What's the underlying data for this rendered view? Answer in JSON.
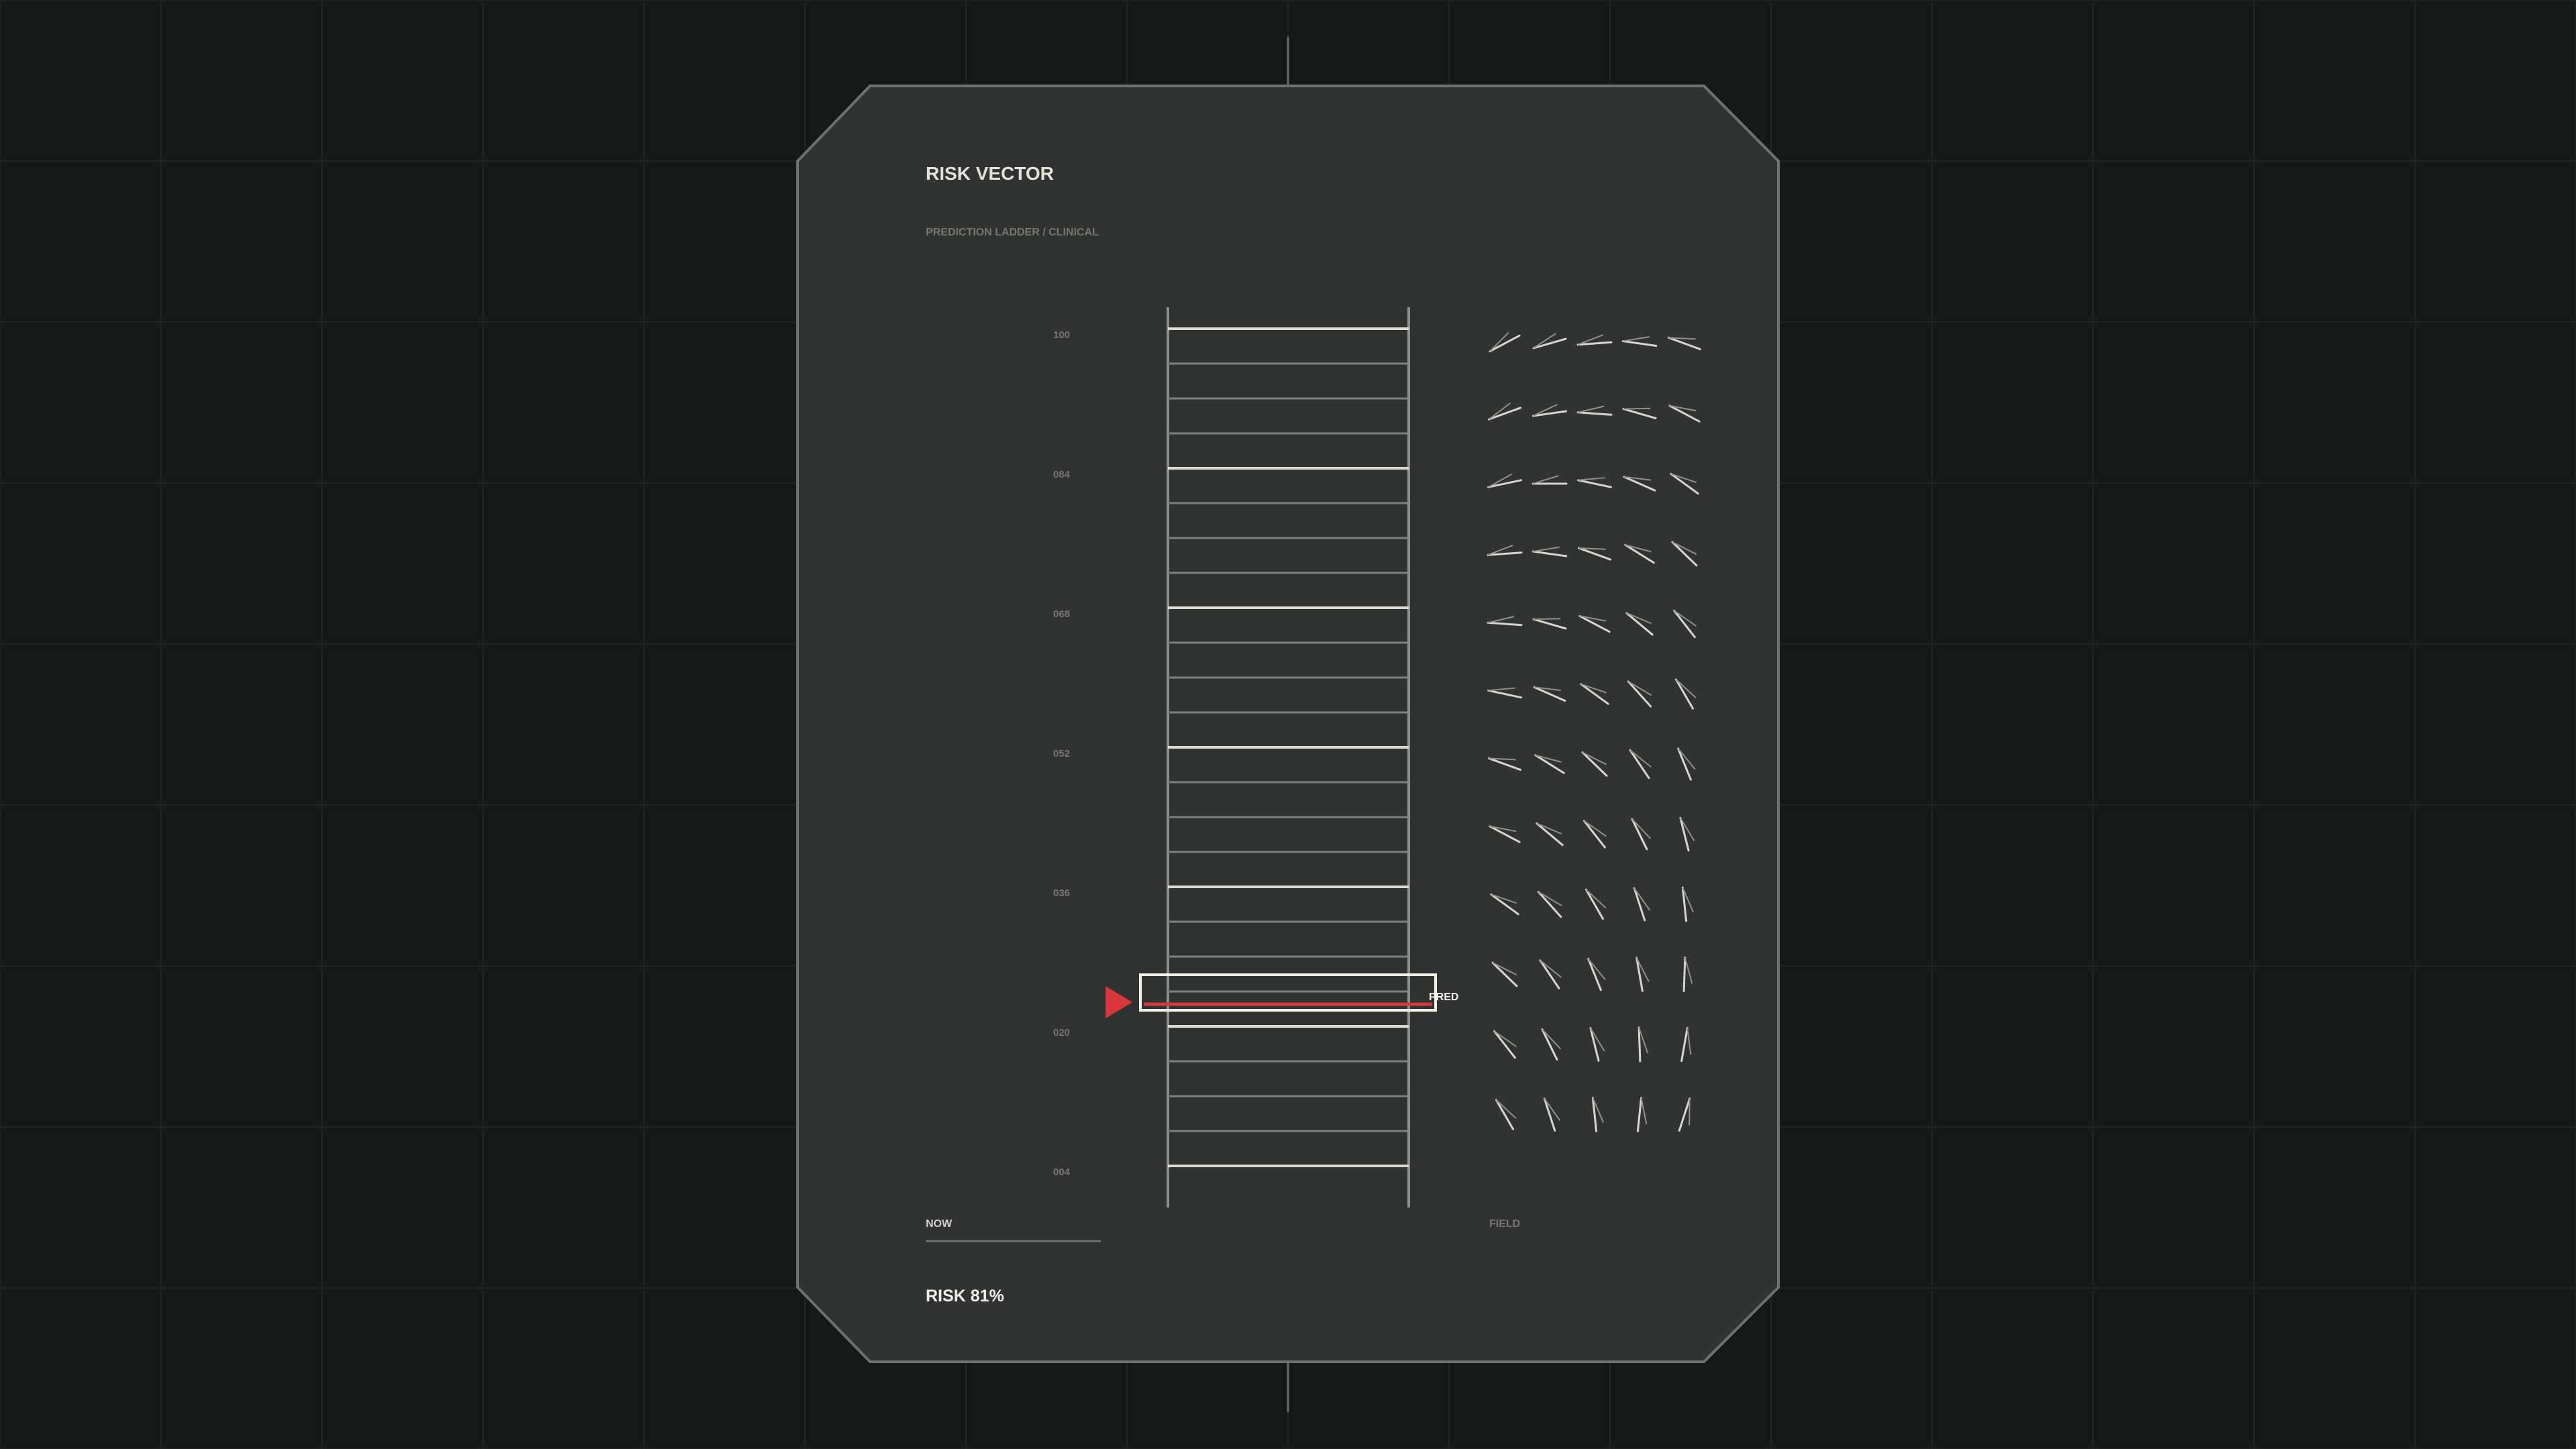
{
  "title": "RISK VECTOR",
  "subtitle": "PREDICTION LADDER / CLINICAL",
  "ladder": {
    "scale_labels": [
      "100",
      "084",
      "068",
      "052",
      "036",
      "020",
      "004"
    ],
    "prediction_label": "PRED"
  },
  "footer": {
    "now_label": "NOW",
    "field_label": "FIELD",
    "risk_readout": "RISK 81%"
  },
  "colors": {
    "background": "#171918",
    "grid": "#232625",
    "panel": "#313332",
    "panel_border": "#6f716e",
    "rail": "#8d8f8b",
    "rung_major": "#dcdbd3",
    "rung_minor": "#7e807c",
    "label_dim": "#75776f",
    "title": "#e3e2da",
    "highlight": "#f2f1ea",
    "accent_red": "#d9363d"
  },
  "icons": {
    "pointer": "triangle-pointer-icon",
    "field_marks": "vector-field-glyphs"
  }
}
